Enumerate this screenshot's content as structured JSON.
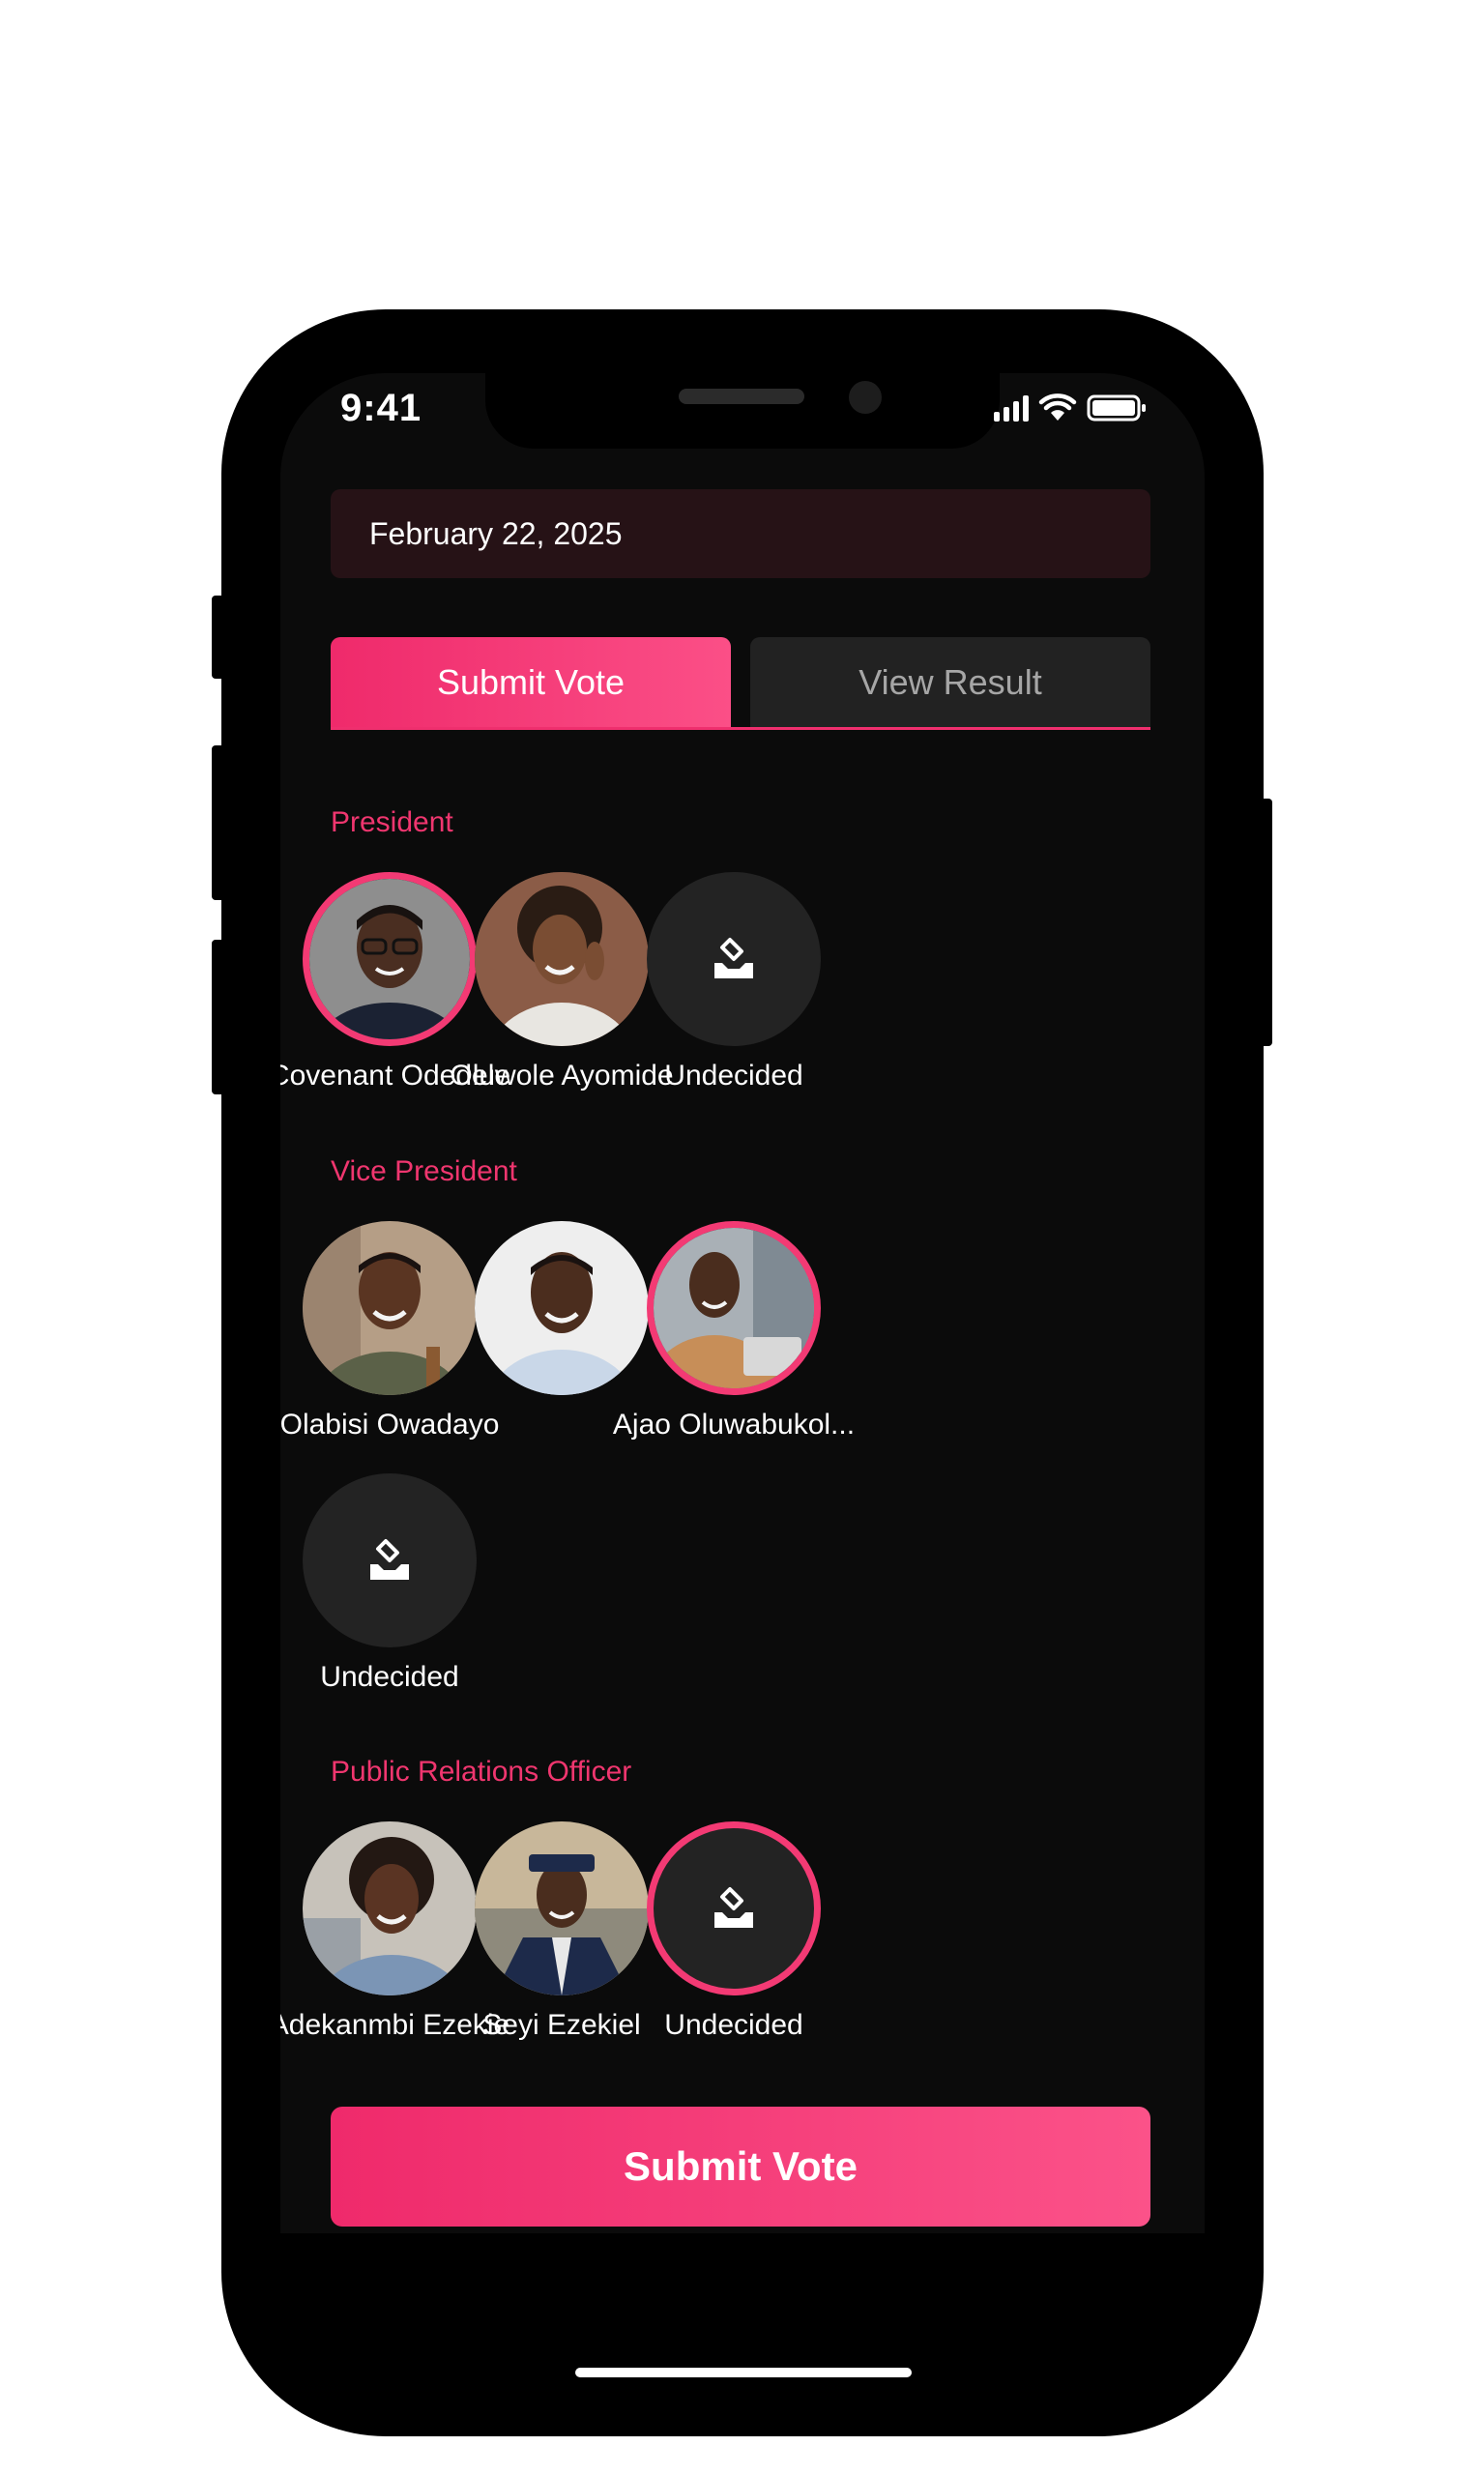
{
  "status_bar": {
    "time": "9:41"
  },
  "date": "February 22, 2025",
  "tabs": [
    {
      "label": "Submit Vote",
      "active": true
    },
    {
      "label": "View Result",
      "active": false
    }
  ],
  "sections": [
    {
      "title": "President",
      "candidates": [
        {
          "name": "Covenant Odedele",
          "selected": true
        },
        {
          "name": "Oluwole Ayomide",
          "selected": false
        },
        {
          "name": "Undecided",
          "selected": false,
          "icon": "ballot-box-icon"
        }
      ]
    },
    {
      "title": "Vice President",
      "candidates": [
        {
          "name": "Olabisi Owadayo",
          "selected": false
        },
        {
          "name": "",
          "selected": false
        },
        {
          "name": "Ajao Oluwabukol...",
          "selected": true
        },
        {
          "name": "Undecided",
          "selected": false,
          "icon": "ballot-box-icon"
        }
      ]
    },
    {
      "title": "Public Relations Officer",
      "candidates": [
        {
          "name": "Adekanmbi Ezekie",
          "selected": false
        },
        {
          "name": "Seyi Ezekiel",
          "selected": false
        },
        {
          "name": "Undecided",
          "selected": true,
          "icon": "ballot-box-icon"
        }
      ]
    }
  ],
  "submit_label": "Submit Vote",
  "colors": {
    "accent": "#F0366F",
    "background": "#0B0B0B",
    "date_field": "#261216"
  }
}
